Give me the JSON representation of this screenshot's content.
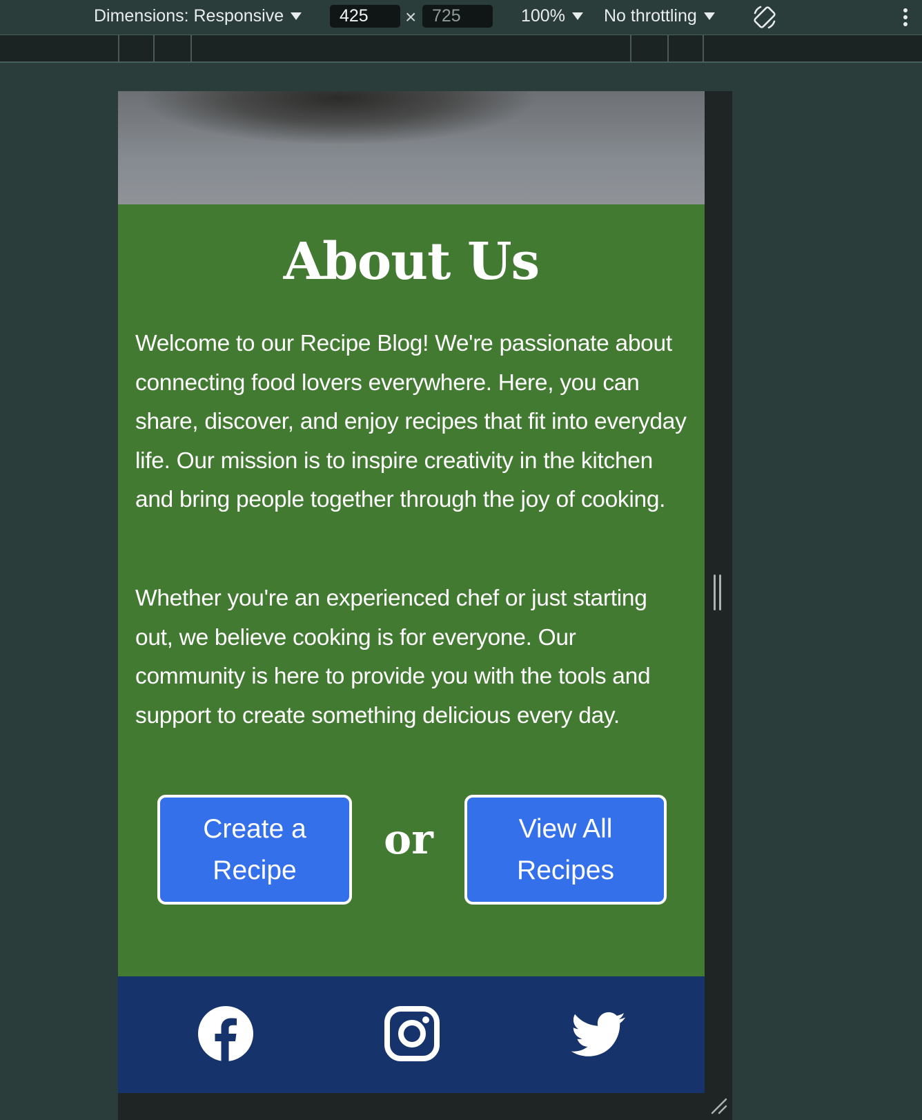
{
  "devtools": {
    "dimensions_label": "Dimensions: Responsive",
    "width_value": "425",
    "height_value": "725",
    "times_symbol": "×",
    "zoom_label": "100%",
    "throttle_label": "No throttling"
  },
  "about": {
    "title": "About Us",
    "paragraph_1": "Welcome to our Recipe Blog! We're passionate about connecting food lovers everywhere. Here, you can share, discover, and enjoy recipes that fit into everyday life. Our mission is to inspire creativity in the kitchen and bring people together through the joy of cooking.",
    "paragraph_2": "Whether you're an experienced chef or just starting out, we believe cooking is for everyone. Our community is here to provide you with the tools and support to create something delicious every day."
  },
  "actions": {
    "create_label": "Create a Recipe",
    "or_label": "or",
    "view_label": "View All Recipes"
  },
  "footer": {
    "icons": [
      "facebook-icon",
      "instagram-icon",
      "twitter-icon"
    ]
  },
  "colors": {
    "about_bg": "#437a32",
    "button_bg": "#3470ea",
    "footer_bg": "#17336b",
    "devtools_bg": "#2b3d3b"
  }
}
